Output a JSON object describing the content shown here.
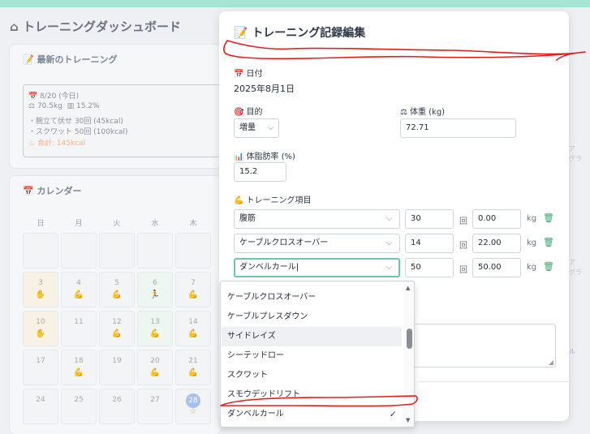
{
  "dashboard": {
    "title": "トレーニングダッシュボード",
    "recent": {
      "heading": "最新のトレーニング",
      "date": "8/20 (今日)",
      "weight": "70.5kg",
      "bodyfat": "15.2%",
      "items": [
        "・腕立て伏せ 30回 (45kcal)",
        "・スクワット 50回 (100kcal)"
      ],
      "total": "合計: 145kcal"
    },
    "calendar": {
      "heading": "カレンダー",
      "weekdays": [
        "日",
        "月",
        "火",
        "水",
        "木"
      ],
      "rows": [
        [
          "",
          "",
          "",
          "",
          ""
        ],
        [
          "3",
          "4",
          "5",
          "6",
          "7"
        ],
        [
          "10",
          "11",
          "12",
          "13",
          "14"
        ],
        [
          "17",
          "18",
          "19",
          "20",
          "21"
        ],
        [
          "24",
          "25",
          "26",
          "27",
          "28"
        ]
      ]
    }
  },
  "modal": {
    "title": "トレーニング記録編集",
    "date_label": "日付",
    "date_value": "2025年8月1日",
    "goal_label": "目的",
    "goal_value": "増量",
    "weight_label": "体重 (kg)",
    "weight_value": "72.71",
    "bodyfat_label": "体脂肪率 (%)",
    "bodyfat_value": "15.2",
    "items_label": "トレーニング項目",
    "rep_unit": "回",
    "weight_unit": "kg",
    "items": [
      {
        "exercise": "腹筋",
        "reps": "30",
        "weight": "0.00"
      },
      {
        "exercise": "ケーブルクロスオーバー",
        "reps": "14",
        "weight": "22.00"
      },
      {
        "exercise": "ダンベルカール",
        "reps": "50",
        "weight": "50.00"
      }
    ]
  },
  "dropdown": {
    "options": [
      "ケーブルクロスオーバー",
      "ケーブルプレスダウン",
      "サイドレイズ",
      "シーテッドロー",
      "スクワット",
      "スモウデッドリフト",
      "ダンベルカール"
    ],
    "selected": "ダンベルカール",
    "highlighted": "サイドレイズ"
  },
  "icons": {
    "home": "home-icon",
    "memo": "memo-icon",
    "calendar": "calendar-icon",
    "target": "target-icon",
    "scale": "scale-icon",
    "chart": "bar-chart-icon",
    "muscle": "muscle-icon",
    "trash": "trash-icon",
    "fire": "fire-icon"
  },
  "colors": {
    "accent": "#6cc7a4",
    "topbar": "#a6e4d3",
    "trash": "#2fa86b",
    "annotation": "#e02020"
  }
}
